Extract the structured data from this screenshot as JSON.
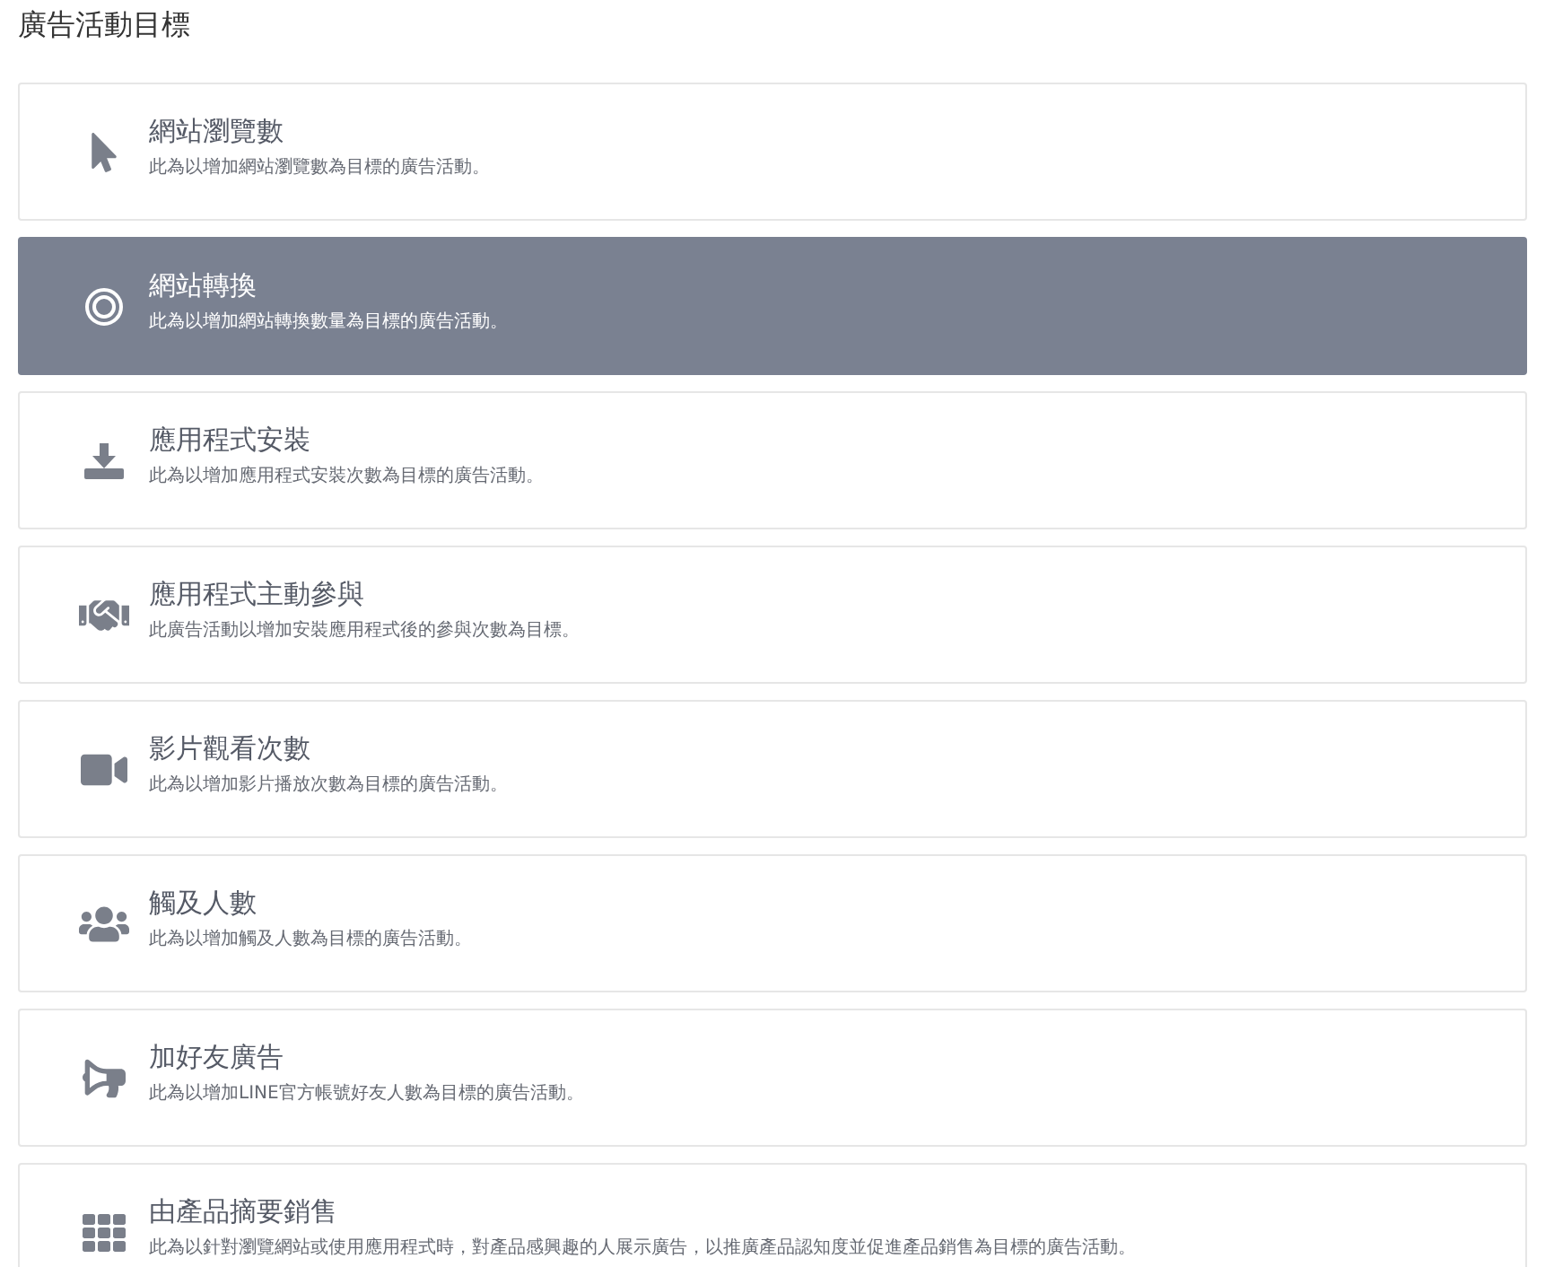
{
  "heading": "廣告活動目標",
  "objectives": [
    {
      "title": "網站瀏覽數",
      "description": "此為以增加網站瀏覽數為目標的廣告活動。",
      "selected": false
    },
    {
      "title": "網站轉換",
      "description": "此為以增加網站轉換數量為目標的廣告活動。",
      "selected": true
    },
    {
      "title": "應用程式安裝",
      "description": "此為以增加應用程式安裝次數為目標的廣告活動。",
      "selected": false
    },
    {
      "title": "應用程式主動參與",
      "description": "此廣告活動以增加安裝應用程式後的參與次數為目標。",
      "selected": false
    },
    {
      "title": "影片觀看次數",
      "description": "此為以增加影片播放次數為目標的廣告活動。",
      "selected": false
    },
    {
      "title": "觸及人數",
      "description": "此為以增加觸及人數為目標的廣告活動。",
      "selected": false
    },
    {
      "title": "加好友廣告",
      "description": "此為以增加LINE官方帳號好友人數為目標的廣告活動。",
      "selected": false
    },
    {
      "title": "由產品摘要銷售",
      "description": "此為以針對瀏覽網站或使用應用程式時，對產品感興趣的人展示廣告，以推廣產品認知度並促進產品銷售為目標的廣告活動。",
      "selected": false
    }
  ]
}
